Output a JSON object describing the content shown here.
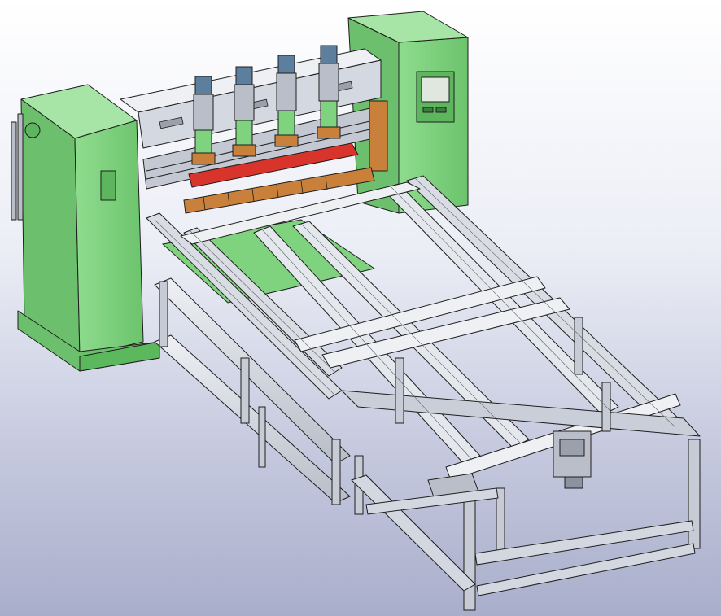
{
  "scene": {
    "subject": "",
    "colors": {
      "machine_green": "#7fd37f",
      "machine_green_dark": "#5cb85c",
      "frame_aluminum": "#d9dce3",
      "frame_shadow": "#a7acb8",
      "electrode_red": "#d9342b",
      "electrode_copper": "#c9803a",
      "cylinder_blue": "#5d7f9e",
      "cylinder_gray": "#b9bec8",
      "outline": "#1e1e1e",
      "background_top": "#ffffff",
      "background_bottom": "#a9aecb"
    },
    "icons": [
      "vent-grille-icon",
      "control-panel-screen-icon",
      "cabinet-handle-icon"
    ]
  }
}
